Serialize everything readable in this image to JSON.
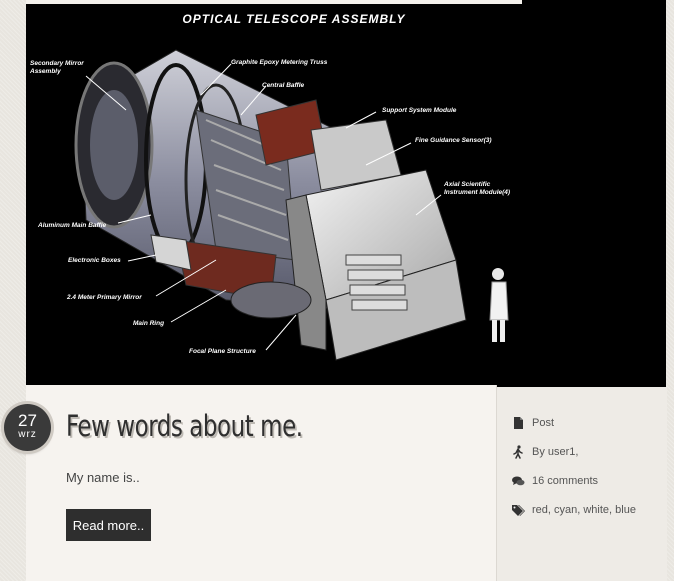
{
  "hero": {
    "title": "OPTICAL TELESCOPE ASSEMBLY",
    "callouts": {
      "secondary_mirror": "Secondary Mirror\nAssembly",
      "graphite_truss": "Graphite Epoxy Metering Truss",
      "central_baffle": "Central Baffle",
      "support_system": "Support System Module",
      "fine_guidance": "Fine Guidance Sensor(3)",
      "axial_scientific": "Axial Scientific\nInstrument Module(4)",
      "aluminum_baffle": "Aluminum Main Baffle",
      "electronic_boxes": "Electronic Boxes",
      "primary_mirror": "2.4 Meter Primary Mirror",
      "main_ring": "Main Ring",
      "focal_plane": "Focal Plane Structure"
    }
  },
  "post": {
    "date_day": "27",
    "date_month": "wrz",
    "title": "Few words about me.",
    "excerpt": "My name is..",
    "read_more": "Read more.."
  },
  "meta": {
    "type": "Post",
    "author": "By user1,",
    "comments": "16 comments",
    "tags": "red, cyan, white, blue"
  },
  "colors": {
    "badge": "#3a3a3a",
    "button": "#2e2e2e",
    "card": "#f6f3ef",
    "panel": "#eeebe6"
  }
}
